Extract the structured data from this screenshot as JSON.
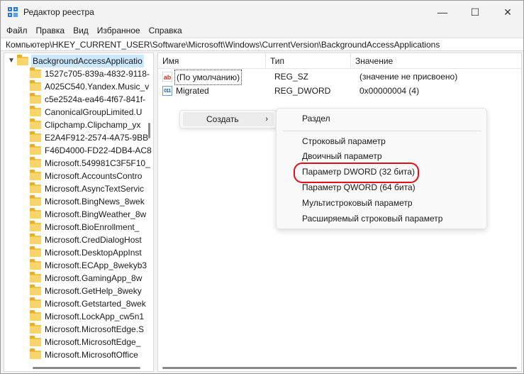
{
  "window": {
    "title": "Редактор реестра",
    "minimize": "—",
    "maximize": "☐",
    "close": "✕"
  },
  "menu": [
    "Файл",
    "Правка",
    "Вид",
    "Избранное",
    "Справка"
  ],
  "address": "Компьютер\\HKEY_CURRENT_USER\\Software\\Microsoft\\Windows\\CurrentVersion\\BackgroundAccessApplications",
  "tree": {
    "root": "BackgroundAccessApplicatio",
    "items": [
      "1527c705-839a-4832-9118-",
      "A025C540.Yandex.Music_v",
      "c5e2524a-ea46-4f67-841f-",
      "CanonicalGroupLimited.U",
      "Clipchamp.Clipchamp_yx",
      "E2A4F912-2574-4A75-9BB",
      "F46D4000-FD22-4DB4-AC8",
      "Microsoft.549981C3F5F10_",
      "Microsoft.AccountsContro",
      "Microsoft.AsyncTextServic",
      "Microsoft.BingNews_8wek",
      "Microsoft.BingWeather_8w",
      "Microsoft.BioEnrollment_",
      "Microsoft.CredDialogHost",
      "Microsoft.DesktopAppInst",
      "Microsoft.ECApp_8wekyb3",
      "Microsoft.GamingApp_8w",
      "Microsoft.GetHelp_8weky",
      "Microsoft.Getstarted_8wek",
      "Microsoft.LockApp_cw5n1",
      "Microsoft.MicrosoftEdge.S",
      "Microsoft.MicrosoftEdge_",
      "Microsoft.MicrosoftOffice"
    ]
  },
  "list": {
    "columns": [
      "Имя",
      "Тип",
      "Значение"
    ],
    "rows": [
      {
        "name": "(По умолчанию)",
        "type": "REG_SZ",
        "value": "(значение не присвоено)",
        "icon": "ab"
      },
      {
        "name": "Migrated",
        "type": "REG_DWORD",
        "value": "0x00000004 (4)",
        "icon": "011"
      }
    ]
  },
  "context_menu": {
    "create": "Создать",
    "arrow": "›"
  },
  "submenu": {
    "items": [
      "Раздел",
      "Строковый параметр",
      "Двоичный параметр",
      "Параметр DWORD (32 бита)",
      "Параметр QWORD (64 бита)",
      "Мультистроковый параметр",
      "Расширяемый строковый параметр"
    ]
  },
  "colors": {
    "selection": "#cce8ff",
    "highlight_ring": "#e0101a",
    "folder": "#f2c24d"
  }
}
